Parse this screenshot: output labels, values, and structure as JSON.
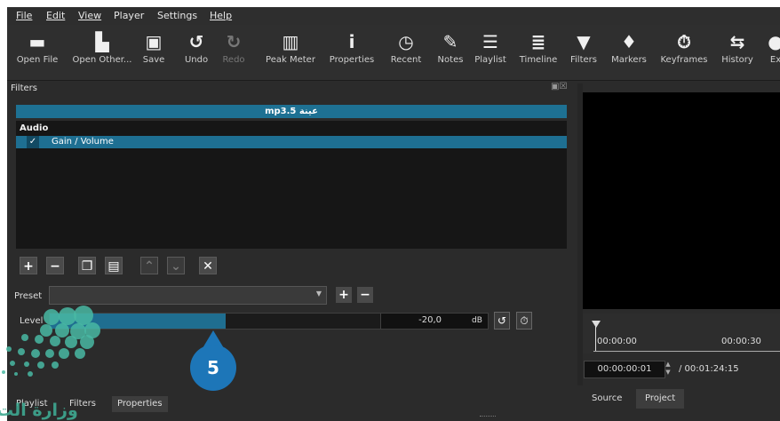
{
  "menu": {
    "items": [
      {
        "label": "File",
        "underline": true
      },
      {
        "label": "Edit",
        "underline": true
      },
      {
        "label": "View",
        "underline": true
      },
      {
        "label": "Player",
        "underline": false
      },
      {
        "label": "Settings",
        "underline": false
      },
      {
        "label": "Help",
        "underline": true
      }
    ]
  },
  "toolbar": {
    "items": [
      {
        "label": "Open File",
        "icon": "folder-icon",
        "glyph": "▬",
        "enabled": true
      },
      {
        "label": "Open Other...",
        "icon": "open-other-icon",
        "glyph": "▙",
        "enabled": true
      },
      {
        "label": "Save",
        "icon": "save-icon",
        "glyph": "▣",
        "enabled": true
      },
      {
        "label": "Undo",
        "icon": "undo-icon",
        "glyph": "↺",
        "enabled": true
      },
      {
        "label": "Redo",
        "icon": "redo-icon",
        "glyph": "↻",
        "enabled": false
      },
      {
        "label": "Peak Meter",
        "icon": "peak-meter-icon",
        "glyph": "▥",
        "enabled": true
      },
      {
        "label": "Properties",
        "icon": "info-icon",
        "glyph": "i",
        "enabled": true
      },
      {
        "label": "Recent",
        "icon": "clock-icon",
        "glyph": "◷",
        "enabled": true
      },
      {
        "label": "Notes",
        "icon": "notes-icon",
        "glyph": "✎",
        "enabled": true
      },
      {
        "label": "Playlist",
        "icon": "playlist-icon",
        "glyph": "☰",
        "enabled": true
      },
      {
        "label": "Timeline",
        "icon": "timeline-icon",
        "glyph": "≣",
        "enabled": true
      },
      {
        "label": "Filters",
        "icon": "filter-icon",
        "glyph": "▼",
        "enabled": true
      },
      {
        "label": "Markers",
        "icon": "marker-icon",
        "glyph": "♦",
        "enabled": true
      },
      {
        "label": "Keyframes",
        "icon": "stopwatch-icon",
        "glyph": "⏱",
        "enabled": true
      },
      {
        "label": "History",
        "icon": "history-icon",
        "glyph": "⇆",
        "enabled": true
      },
      {
        "label": "Ex",
        "icon": "export-icon",
        "glyph": "●",
        "enabled": true
      }
    ]
  },
  "filters_panel": {
    "title": "Filters",
    "clip_name": "mp3.5 عينة",
    "group": "Audio",
    "filter": {
      "name": "Gain / Volume",
      "checked": true,
      "check_glyph": "✓"
    },
    "buttons": [
      {
        "name": "add-filter-button",
        "glyph": "+",
        "dim": false
      },
      {
        "name": "remove-filter-button",
        "glyph": "−",
        "dim": false
      },
      {
        "name": "copy-filter-button",
        "glyph": "❐",
        "dim": false
      },
      {
        "name": "paste-filter-button",
        "glyph": "▤",
        "dim": false
      },
      {
        "name": "move-up-button",
        "glyph": "⌃",
        "dim": true
      },
      {
        "name": "move-down-button",
        "glyph": "⌄",
        "dim": true
      },
      {
        "name": "close-filter-button",
        "glyph": "✕",
        "dim": false
      }
    ],
    "preset": {
      "label": "Preset",
      "value": "",
      "add_glyph": "+",
      "remove_glyph": "−"
    },
    "level": {
      "label": "Level",
      "value": "-20,0",
      "unit": "dB",
      "fill_fraction": 0.4,
      "reset_glyph": "↺",
      "keyframe_glyph": "⏱"
    }
  },
  "bottom_tabs": [
    "Playlist",
    "Filters",
    "Properties"
  ],
  "viewer": {
    "ruler_labels": [
      "00:00:00",
      "00:00:30"
    ],
    "timecode": "00:00:00:01",
    "duration": "/ 00:01:24:15",
    "tabs": [
      "Source",
      "Project"
    ]
  },
  "callout": {
    "number": "5",
    "color": "#1d76b8"
  },
  "watermark": {
    "text": "وزارة الت"
  },
  "colors": {
    "accent": "#1e7193",
    "background": "#2b2b2b"
  }
}
